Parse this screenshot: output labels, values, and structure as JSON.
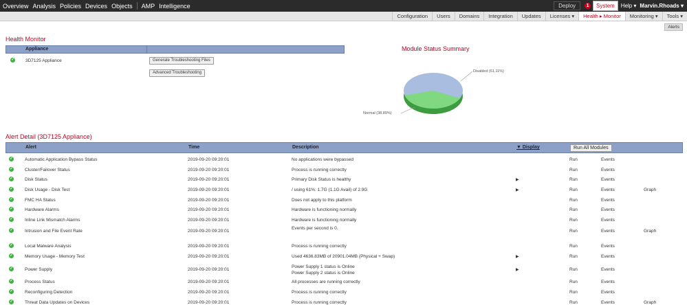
{
  "topnav": {
    "items": [
      "Overview",
      "Analysis",
      "Policies",
      "Devices",
      "Objects"
    ],
    "items2": [
      "AMP",
      "Intelligence"
    ]
  },
  "topright": {
    "deploy": "Deploy",
    "alert_count": "1",
    "system": "System",
    "help": "Help ▾",
    "user": "Marvin.Rhoads ▾"
  },
  "subnav": {
    "items": [
      "Configuration",
      "Users",
      "Domains",
      "Integration",
      "Updates",
      "Licenses ▾",
      "Health ▸ Monitor",
      "Monitoring ▾",
      "Tools ▾"
    ],
    "active_index": 6
  },
  "alerts_button": "Alerts",
  "health_monitor": {
    "title": "Health Monitor",
    "header": "Appliance",
    "appliance": "3D7125 Appliance",
    "btn_generate": "Generate Troubleshooting Files",
    "btn_advanced": "Advanced Troubleshooting"
  },
  "module_summary": {
    "title": "Module Status Summary",
    "disabled_label": "Disabled (61.11%)",
    "normal_label": "Normal (38.89%)",
    "disabled_pct": 61.11,
    "normal_pct": 38.89,
    "colors": {
      "disabled": "#a8bde0",
      "normal": "#80d880"
    }
  },
  "alert_detail": {
    "title": "Alert Detail (3D7125 Appliance)",
    "headers": {
      "alert": "Alert",
      "time": "Time",
      "description": "Description",
      "display": "▼ Display",
      "run_all": "Run All Modules"
    },
    "rows": [
      {
        "alert": "Automatic Application Bypass Status",
        "time": "2019-09-20 09:20:01",
        "desc": "No applications were bypassed",
        "desc2": "",
        "arrow": false,
        "run": "Run",
        "events": "Events",
        "graph": ""
      },
      {
        "alert": "Cluster/Failover Status",
        "time": "2019-09-20 09:20:01",
        "desc": "Process is running correctly",
        "desc2": "",
        "arrow": false,
        "run": "Run",
        "events": "Events",
        "graph": ""
      },
      {
        "alert": "Disk Status",
        "time": "2019-09-20 09:20:01",
        "desc": "Primary Disk Status is healthy",
        "desc2": "",
        "arrow": true,
        "run": "Run",
        "events": "Events",
        "graph": ""
      },
      {
        "alert": "Disk Usage - Disk Test",
        "time": "2019-09-20 09:20:01",
        "desc": "/ using 61%: 1.7G (1.1G Avail) of 2.9G",
        "desc2": "",
        "arrow": true,
        "run": "Run",
        "events": "Events",
        "graph": "Graph"
      },
      {
        "alert": "FMC HA Status",
        "time": "2019-09-20 09:20:01",
        "desc": "Does not apply to this platform",
        "desc2": "",
        "arrow": false,
        "run": "Run",
        "events": "Events",
        "graph": ""
      },
      {
        "alert": "Hardware Alarms",
        "time": "2019-09-20 09:20:01",
        "desc": "Hardware is functioning normally",
        "desc2": "",
        "arrow": false,
        "run": "Run",
        "events": "Events",
        "graph": ""
      },
      {
        "alert": "Inline Link Mismatch Alarms",
        "time": "2019-09-20 09:20:01",
        "desc": "Hardware is functioning normally",
        "desc2": "",
        "arrow": false,
        "run": "Run",
        "events": "Events",
        "graph": ""
      },
      {
        "alert": "Intrusion and File Event Rate",
        "time": "2019-09-20 09:20:01",
        "desc": "Events per second is 0.",
        "desc2": "",
        "arrow": false,
        "run": "Run",
        "events": "Events",
        "graph": "Graph"
      },
      {
        "alert": "Local Malware Analysis",
        "time": "2019-09-20 09:20:01",
        "desc": "Process is running correctly",
        "desc2": "",
        "arrow": false,
        "run": "Run",
        "events": "Events",
        "graph": ""
      },
      {
        "alert": "Memory Usage - Memory Test",
        "time": "2019-09-20 09:20:01",
        "desc": "Used 4636.83MB of 20901.04MB (Physical + Swap)",
        "desc2": "",
        "arrow": true,
        "run": "Run",
        "events": "Events",
        "graph": ""
      },
      {
        "alert": "Power Supply",
        "time": "2019-09-20 09:20:01",
        "desc": "Power Supply 1 status is Online",
        "desc2": "Power Supply 2 status is Online",
        "arrow": true,
        "run": "Run",
        "events": "Events",
        "graph": ""
      },
      {
        "alert": "Process Status",
        "time": "2019-09-20 09:20:01",
        "desc": "All processes are running correctly",
        "desc2": "",
        "arrow": false,
        "run": "Run",
        "events": "Events",
        "graph": ""
      },
      {
        "alert": "Reconfiguring Detection",
        "time": "2019-09-20 09:20:01",
        "desc": "Process is running correctly",
        "desc2": "",
        "arrow": false,
        "run": "Run",
        "events": "Events",
        "graph": ""
      },
      {
        "alert": "Threat Data Updates on Devices",
        "time": "2019-09-20 09:20:01",
        "desc": "Process is running correctly",
        "desc2": "",
        "arrow": false,
        "run": "Run",
        "events": "Events",
        "graph": "Graph"
      }
    ]
  }
}
